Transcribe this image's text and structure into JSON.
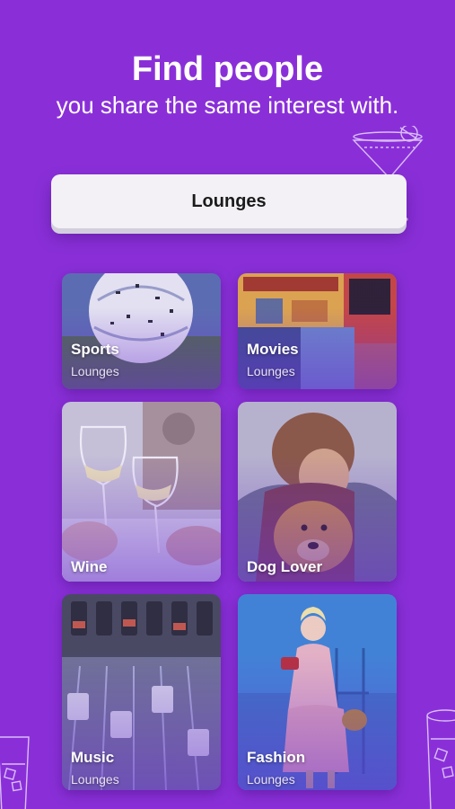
{
  "header": {
    "title": "Find people",
    "subtitle": "you share the same interest with."
  },
  "lounges_button": {
    "label": "Lounges"
  },
  "tiles": [
    {
      "label": "Sports",
      "sublabel": "Lounges"
    },
    {
      "label": "Movies",
      "sublabel": "Lounges"
    },
    {
      "label": "Wine",
      "sublabel": ""
    },
    {
      "label": "Dog Lover",
      "sublabel": ""
    },
    {
      "label": "Music",
      "sublabel": "Lounges"
    },
    {
      "label": "Fashion",
      "sublabel": "Lounges"
    }
  ],
  "colors": {
    "background": "#8a2fd8",
    "button_bg": "#f3f1f6",
    "text_primary": "#ffffff"
  },
  "icons": [
    "cocktail-glass-icon",
    "tumbler-glass-icon"
  ]
}
